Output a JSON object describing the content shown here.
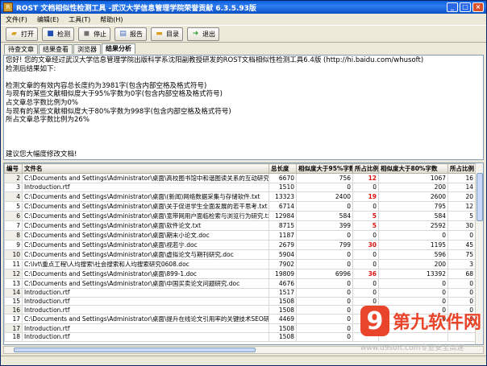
{
  "window": {
    "title": "ROST 文档相似性检测工具 -武汉大学信息管理学院荣誉贡献 6.3.5.93版"
  },
  "menu": [
    "文件(F)",
    "编辑(E)",
    "工具(T)",
    "帮助(H)"
  ],
  "toolbar": {
    "open": "打开",
    "detect": "检测",
    "stop": "停止",
    "report": "报告",
    "catalog": "目录",
    "exit": "退出"
  },
  "tabs": [
    "待查文章",
    "结果查看",
    "浏览器",
    "结果分析"
  ],
  "report": {
    "lines": [
      "您好! 您的文章经过武汉大学信息管理学院出版科学系沈阳副教授研发的ROST文档相似性检测工具6.4版 (http://hi.baidu.com/whusoft)",
      "检测后结果如下:",
      "",
      "检测文章的有效内容总长度约为3981字(包含内部空格及格式符号)",
      "与现有的某些文献相似度大于95%字数为0字(包含内部空格及格式符号)",
      "占文章总字数比例为0%",
      "与现有的某些文献相似度大于80%字数为998字(包含内部空格及格式符号)",
      "所占文章总字数比例为26%",
      "",
      "",
      "",
      "建议您大幅度修改文档!"
    ]
  },
  "grid": {
    "columns": [
      "编号",
      "文件名",
      "总长度",
      "相似度大于95%字数",
      "所占比例",
      "相似度大于80%字数",
      "所占比例"
    ],
    "rows": [
      {
        "idx": "2",
        "file": "C:\\Documents and Settings\\Administrator\\桌面\\高校图书馆中和谐图读关系的互动研究1.txt",
        "len": "6670",
        "s95": "756",
        "p95": "12",
        "s80": "1067",
        "p80": "16"
      },
      {
        "idx": "3",
        "file": "Introduction.rtf",
        "len": "1510",
        "s95": "0",
        "p95": "0",
        "s80": "200",
        "p80": "14"
      },
      {
        "idx": "4",
        "file": "C:\\Documents and Settings\\Administrator\\桌面\\(新闻)网络数据采集与存储软件.txt",
        "len": "13323",
        "s95": "2400",
        "p95": "19",
        "s80": "2600",
        "p80": "20"
      },
      {
        "idx": "5",
        "file": "C:\\Documents and Settings\\Administrator\\桌面\\关于促进学生全面发展的若干思考.txt",
        "len": "6714",
        "s95": "0",
        "p95": "0",
        "s80": "795",
        "p80": "12"
      },
      {
        "idx": "6",
        "file": "C:\\Documents and Settings\\Administrator\\桌面\\宽带网用户面临检索与浏览行为研究.txt",
        "len": "12984",
        "s95": "584",
        "p95": "5",
        "s80": "584",
        "p80": "5"
      },
      {
        "idx": "7",
        "file": "C:\\Documents and Settings\\Administrator\\桌面\\软件论文.txt",
        "len": "8715",
        "s95": "399",
        "p95": "5",
        "s80": "2592",
        "p80": "30"
      },
      {
        "idx": "8",
        "file": "C:\\Documents and Settings\\Administrator\\桌面\\期末小论文.doc",
        "len": "1187",
        "s95": "0",
        "p95": "0",
        "s80": "0",
        "p80": "0"
      },
      {
        "idx": "9",
        "file": "C:\\Documents and Settings\\Administrator\\桌面\\视若宁.doc",
        "len": "2679",
        "s95": "799",
        "p95": "30",
        "s80": "1195",
        "p80": "45"
      },
      {
        "idx": "10",
        "file": "C:\\Documents and Settings\\Administrator\\桌面\\虚拟论文与期刊研究.doc",
        "len": "5904",
        "s95": "0",
        "p95": "0",
        "s80": "596",
        "p80": "75"
      },
      {
        "idx": "11",
        "file": "C:\\lvt\\重点工程\\人均搜索\\社会搜索和人均搜索研究0608.doc",
        "len": "7902",
        "s95": "0",
        "p95": "0",
        "s80": "200",
        "p80": "3"
      },
      {
        "idx": "12",
        "file": "C:\\Documents and Settings\\Administrator\\桌面\\899-1.doc",
        "len": "19809",
        "s95": "6996",
        "p95": "36",
        "s80": "13392",
        "p80": "68"
      },
      {
        "idx": "13",
        "file": "C:\\Documents and Settings\\Administrator\\桌面\\中国买卖论文问题研究.doc",
        "len": "4676",
        "s95": "0",
        "p95": "0",
        "s80": "0",
        "p80": "0"
      },
      {
        "idx": "14",
        "file": "Introduction.rtf",
        "len": "1517",
        "s95": "0",
        "p95": "0",
        "s80": "0",
        "p80": "0"
      },
      {
        "idx": "15",
        "file": "Introduction.rtf",
        "len": "1508",
        "s95": "0",
        "p95": "0",
        "s80": "0",
        "p80": "0"
      },
      {
        "idx": "16",
        "file": "Introduction.rtf",
        "len": "1508",
        "s95": "0",
        "p95": "0",
        "s80": "0",
        "p80": "0"
      },
      {
        "idx": "17",
        "file": "C:\\Documents and Settings\\Administrator\\桌面\\提升在线论文引用率的关键技术SEO研究-小劲修改版.",
        "len": "4469",
        "s95": "0",
        "p95": "0",
        "s80": "0",
        "p80": "0"
      },
      {
        "idx": "17",
        "file": "Introduction.rtf",
        "len": "1508",
        "s95": "0",
        "p95": "",
        "s80": "",
        "p80": ""
      },
      {
        "idx": "18",
        "file": "Introduction.rtf",
        "len": "1508",
        "s95": "0",
        "p95": "",
        "s80": "",
        "p80": ""
      }
    ],
    "highlight_color": "#e01010"
  },
  "watermark": {
    "badge": "9",
    "brand": "第九软件网",
    "url": "www.d9soft.com专业安全高速"
  }
}
